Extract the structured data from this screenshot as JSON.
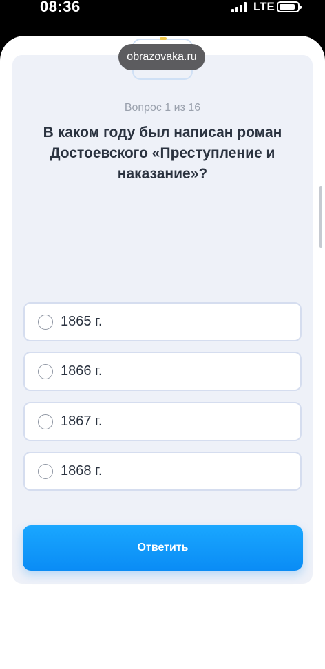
{
  "status_bar": {
    "time": "08:36",
    "carrier": "LTE",
    "icons": [
      "signal-icon",
      "battery-icon"
    ]
  },
  "browser": {
    "url": "obrazovaka.ru"
  },
  "quiz": {
    "counter": "Вопрос 1 из 16",
    "question": "В каком году был написан роман Достоевского «Преступление и наказание»?",
    "options": [
      "1865 г.",
      "1866 г.",
      "1867 г.",
      "1868 г."
    ],
    "submit_label": "Ответить"
  },
  "colors": {
    "accent": "#0a8cf5",
    "card_background": "#eef1f8",
    "option_border": "#d5ddef",
    "text": "#2b3340",
    "muted": "#9aa1ad"
  }
}
